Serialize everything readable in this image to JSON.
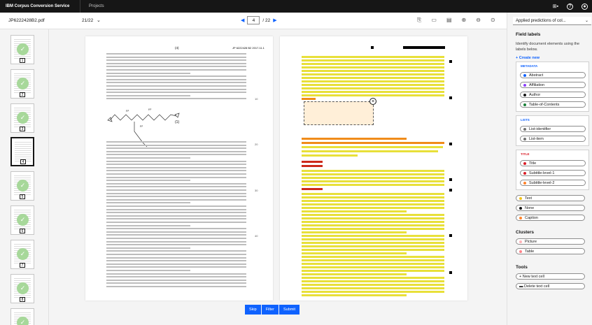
{
  "topbar": {
    "brand": "IBM Corpus Conversion Service",
    "nav": "Projects",
    "badge": "⊞▪"
  },
  "toolbar": {
    "filename": "JP6222428B2.pdf",
    "page_select": "21/22",
    "current_page": "4",
    "total_pages": "/ 22"
  },
  "document": {
    "header_left": "(4)",
    "header_right": "JP 6222428 B2 2017.11.1",
    "chem_label": "(1)",
    "line_numbers": [
      "10",
      "20",
      "30",
      "40"
    ]
  },
  "sidebar": {
    "mode": "Applied predictions of col...",
    "field_labels_title": "Field labels",
    "description": "Identify document elements using the labels below.",
    "create_new": "+ Create new",
    "groups": [
      {
        "title": "METADATA",
        "color": "#0f62fe",
        "items": [
          {
            "label": "Abstract",
            "color": "#0f62fe"
          },
          {
            "label": "Affiliation",
            "color": "#8a3ffc"
          },
          {
            "label": "Author",
            "color": "#161616"
          },
          {
            "label": "Table-of-Contents",
            "color": "#198038"
          }
        ]
      },
      {
        "title": "LISTS",
        "color": "#0f62fe",
        "items": [
          {
            "label": "List-identifier",
            "color": "#6f6f6f"
          },
          {
            "label": "List-item",
            "color": "#6f6f6f"
          }
        ]
      },
      {
        "title": "TITLE",
        "color": "#da1e28",
        "items": [
          {
            "label": "Title",
            "color": "#da1e28"
          },
          {
            "label": "Subtitle-level-1",
            "color": "#da1e28"
          },
          {
            "label": "Subtitle-level-2",
            "color": "#ff832b"
          }
        ]
      }
    ],
    "standalone": [
      {
        "label": "Text",
        "color": "#f1c21b"
      },
      {
        "label": "None",
        "color": "#161616"
      },
      {
        "label": "Caption",
        "color": "#ff832b"
      }
    ],
    "clusters_title": "Clusters",
    "clusters": [
      {
        "label": "Picture",
        "color": "#ffb3b8"
      },
      {
        "label": "Table",
        "color": "#ff8389"
      }
    ],
    "tools_title": "Tools",
    "tools": [
      {
        "label": "+ New text cell"
      },
      {
        "label": "▬ Delete text cell"
      }
    ]
  },
  "actions": {
    "skip": "Skip",
    "filter": "Filter",
    "submit": "Submit"
  },
  "colors": {
    "text_bar": "#e8e03a",
    "caption_bar": "#f08c1a",
    "title_bar": "#cc2a1a",
    "accent": "#0f62fe"
  }
}
